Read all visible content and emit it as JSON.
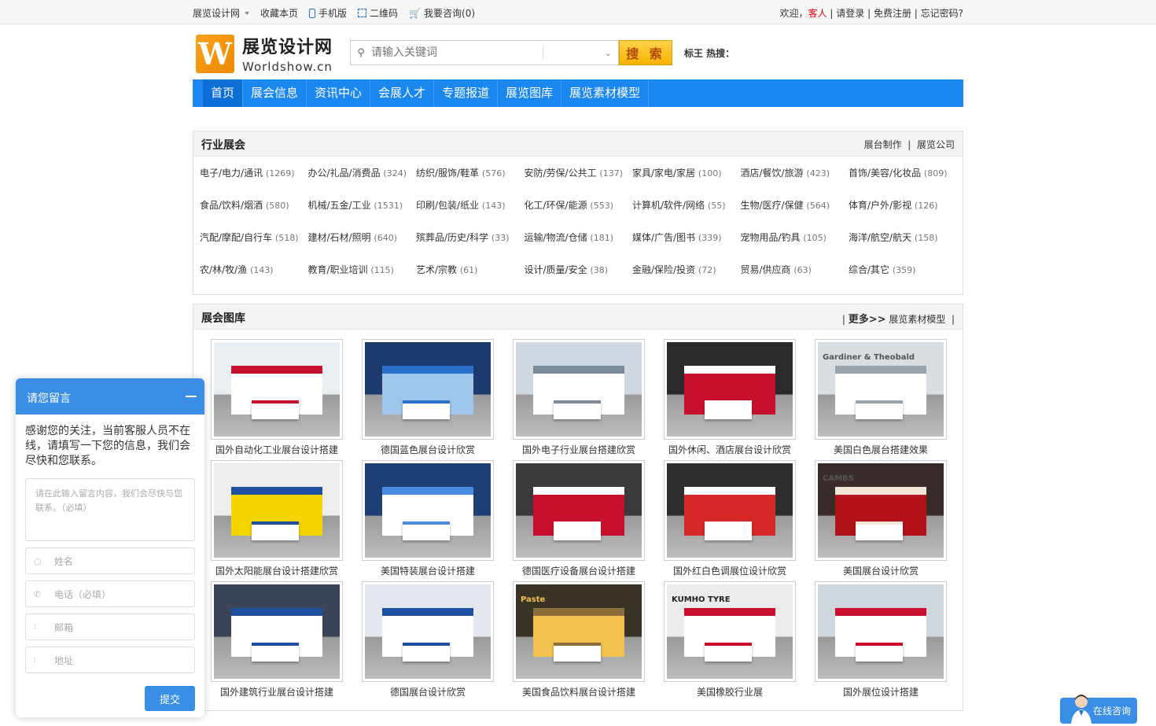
{
  "topbar": {
    "site_name": "展览设计网",
    "bookmark": "收藏本页",
    "mobile": "手机版",
    "qrcode": "二维码",
    "consult": "我要咨询(0)",
    "welcome": "欢迎，",
    "guest": "客人",
    "login": "请登录",
    "register": "免费注册",
    "forgot": "忘记密码?"
  },
  "logo": {
    "mark": "W",
    "cn": "展览设计网",
    "en": "Worldshow.cn"
  },
  "search": {
    "placeholder": "请输入关键词",
    "button": "搜 索",
    "hot": "标王 热搜："
  },
  "nav": [
    "首页",
    "展会信息",
    "资讯中心",
    "会展人才",
    "专题报道",
    "展览图库",
    "展览素材模型"
  ],
  "industry": {
    "title": "行业展会",
    "link1": "展台制作",
    "link2": "展览公司",
    "rows": [
      [
        [
          "电子/电力/通讯",
          "(1269)"
        ],
        [
          "办公/礼品/消费品",
          "(324)"
        ],
        [
          "纺织/服饰/鞋革",
          "(576)"
        ],
        [
          "安防/劳保/公共工",
          "(137)"
        ],
        [
          "家具/家电/家居",
          "(100)"
        ],
        [
          "酒店/餐饮/旅游",
          "(423)"
        ],
        [
          "首饰/美容/化妆品",
          "(809)"
        ]
      ],
      [
        [
          "食品/饮料/烟酒",
          "(580)"
        ],
        [
          "机械/五金/工业",
          "(1531)"
        ],
        [
          "印刷/包装/纸业",
          "(143)"
        ],
        [
          "化工/环保/能源",
          "(553)"
        ],
        [
          "计算机/软件/网络",
          "(55)"
        ],
        [
          "生物/医疗/保健",
          "(564)"
        ],
        [
          "体育/户外/影视",
          "(126)"
        ]
      ],
      [
        [
          "汽配/摩配/自行车",
          "(518)"
        ],
        [
          "建材/石材/照明",
          "(640)"
        ],
        [
          "殡葬品/历史/科学",
          "(33)"
        ],
        [
          "运输/物流/仓储",
          "(181)"
        ],
        [
          "媒体/广告/图书",
          "(339)"
        ],
        [
          "宠物用品/钓具",
          "(105)"
        ],
        [
          "海洋/航空/航天",
          "(158)"
        ]
      ],
      [
        [
          "农/林/牧/渔",
          "(143)"
        ],
        [
          "教育/职业培训",
          "(115)"
        ],
        [
          "艺术/宗教",
          "(61)"
        ],
        [
          "设计/质量/安全",
          "(38)"
        ],
        [
          "金融/保险/投资",
          "(72)"
        ],
        [
          "贸易/供应商",
          "(63)"
        ],
        [
          "综合/其它",
          "(359)"
        ]
      ]
    ]
  },
  "gallery": {
    "title": "展会图库",
    "more": "更多>>",
    "link": "展览素材模型",
    "items": [
      "国外自动化工业展台设计搭建",
      "德国蓝色展台设计欣赏",
      "国外电子行业展台搭建欣赏",
      "国外休闲、酒店展台设计欣赏",
      "美国白色展台搭建效果",
      "国外太阳能展台设计搭建欣赏",
      "美国特装展台设计搭建",
      "德国医疗设备展台设计搭建",
      "国外红白色调展位设计欣赏",
      "美国展台设计欣赏",
      "国外建筑行业展台设计搭建",
      "德国展台设计欣赏",
      "美国食品饮料展台设计搭建",
      "美国橡胶行业展",
      "国外展位设计搭建"
    ],
    "pic_texts": [
      "Gardiner & Theobald",
      "CAMBS",
      "KUMHO TYRE",
      "Paste"
    ]
  },
  "chat": {
    "title": "请您留言",
    "message": "感谢您的关注，当前客服人员不在线，请填写一下您的信息，我们会尽快和您联系。",
    "textarea_placeholder": "请在此输入留言内容，我们会尽快与您联系。（必填）",
    "name": "姓名",
    "phone": "电话（必填）",
    "email": "邮箱",
    "address": "地址",
    "submit": "提交"
  },
  "online": "在线咨询",
  "colors": {
    "nav": "#1b87f0",
    "accent": "#e60012",
    "search_btn": "#f5b400",
    "chat": "#3a8ee6"
  }
}
